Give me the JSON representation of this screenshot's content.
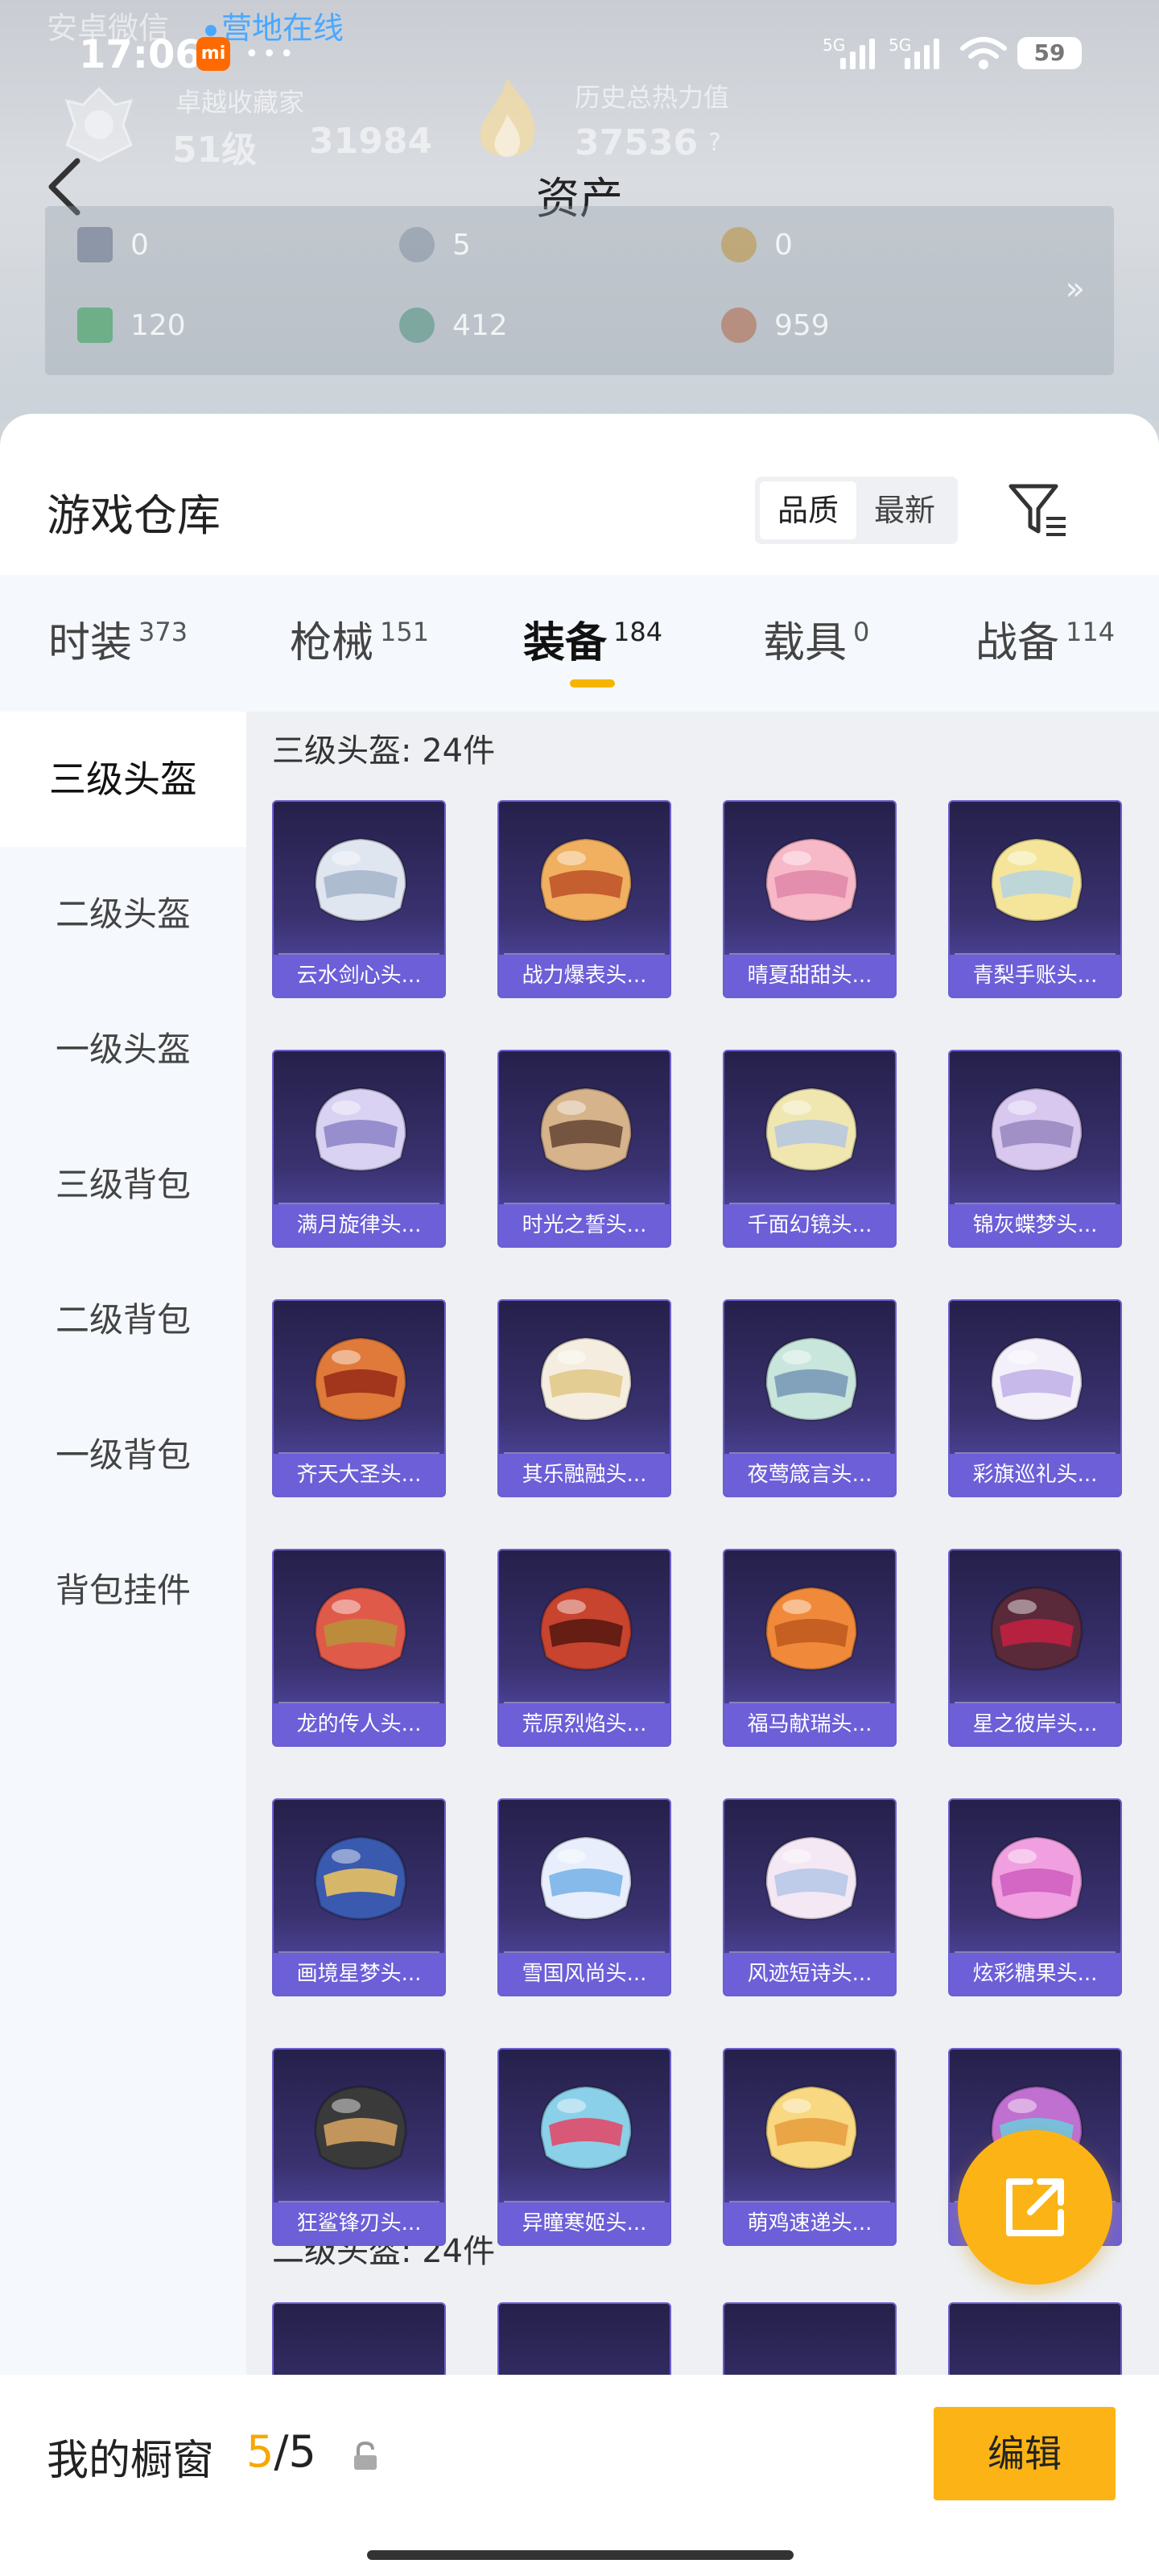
{
  "status_bar": {
    "time": "17:06",
    "mi_badge": "mi",
    "signal_1": "5G",
    "signal_2": "5G",
    "battery": "59"
  },
  "overlay": {
    "wechat_text": "安卓微信",
    "online_text": "营地在线"
  },
  "profile": {
    "collector_label": "卓越收藏家",
    "level": "51级",
    "points": "31984",
    "heat_label": "历史总热力值",
    "heat_value": "37536",
    "help": "?"
  },
  "page": {
    "title": "资产"
  },
  "assets": {
    "row1": [
      "0",
      "5",
      "0"
    ],
    "row2": [
      "120",
      "412",
      "959"
    ],
    "more": "»"
  },
  "warehouse": {
    "title": "游戏仓库",
    "sort_quality": "品质",
    "sort_newest": "最新"
  },
  "categories": [
    {
      "name": "时装",
      "count": "373"
    },
    {
      "name": "枪械",
      "count": "151"
    },
    {
      "name": "装备",
      "count": "184"
    },
    {
      "name": "载具",
      "count": "0"
    },
    {
      "name": "战备",
      "count": "114"
    }
  ],
  "subnav": [
    "三级头盔",
    "二级头盔",
    "一级头盔",
    "三级背包",
    "二级背包",
    "一级背包",
    "背包挂件"
  ],
  "groups": {
    "g1_title": "三级头盔: 24件",
    "g2_title": "二级头盔: 24件"
  },
  "items": [
    "云水剑心头...",
    "战力爆表头...",
    "晴夏甜甜头...",
    "青梨手账头...",
    "满月旋律头...",
    "时光之誓头...",
    "千面幻镜头...",
    "锦灰蝶梦头...",
    "齐天大圣头...",
    "其乐融融头...",
    "夜莺箴言头...",
    "彩旗巡礼头...",
    "龙的传人头...",
    "荒原烈焰头...",
    "福马献瑞头...",
    "星之彼岸头...",
    "画境星梦头...",
    "雪国风尚头...",
    "风迹短诗头...",
    "炫彩糖果头...",
    "狂鲨锋刃头...",
    "异瞳寒姬头...",
    "萌鸡速递头...",
    ""
  ],
  "showcase": {
    "label": "我的橱窗",
    "current": "5",
    "total": "/5",
    "edit": "编辑"
  }
}
